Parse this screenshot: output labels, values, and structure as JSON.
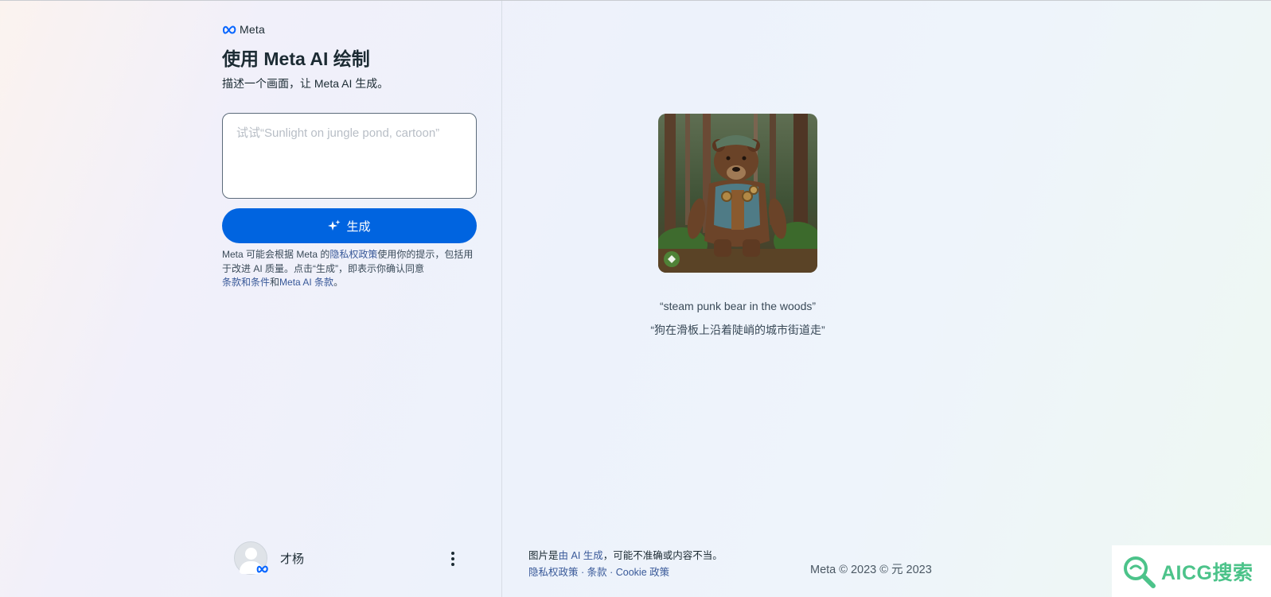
{
  "brand": {
    "logo_text": "Meta",
    "accent": "#0064e0"
  },
  "sidebar": {
    "title": "使用 Meta AI 绘制",
    "subtitle": "描述一个画面，让 Meta AI 生成。",
    "prompt": {
      "value": "",
      "placeholder": "试试“Sunlight on jungle pond, cartoon”"
    },
    "generate_button": {
      "label": "生成",
      "icon": "sparkle-icon"
    },
    "disclaimer": {
      "part1": "Meta 可能会根据 Meta 的",
      "privacy_link": "隐私权政策",
      "part2": "使用你的提示，包括用于改进 AI 质量。点击“生成”，即表示你确认同意",
      "terms_link": "条款和条件",
      "part3": "和",
      "ai_terms_link": "Meta AI 条款",
      "part4": "。"
    },
    "user": {
      "name": "才杨",
      "avatar_icon": "avatar-icon",
      "menu_icon": "more-vertical-icon"
    }
  },
  "main": {
    "example_image": {
      "alt_icon": "steampunk-bear-image"
    },
    "captions": [
      "“steam punk bear in the woods”",
      "“狗在滑板上沿着陡峭的城市街道走”"
    ]
  },
  "footer": {
    "note_prefix": "图片是",
    "note_link": "由 AI 生成",
    "note_suffix": "，可能不准确或内容不当。",
    "links": [
      "隐私权政策",
      "条款",
      "Cookie 政策"
    ],
    "separator": " · ",
    "copyright": "Meta © 2023 © 元 2023"
  },
  "watermark": {
    "text": "AICG搜索",
    "color": "#4cc38a"
  }
}
